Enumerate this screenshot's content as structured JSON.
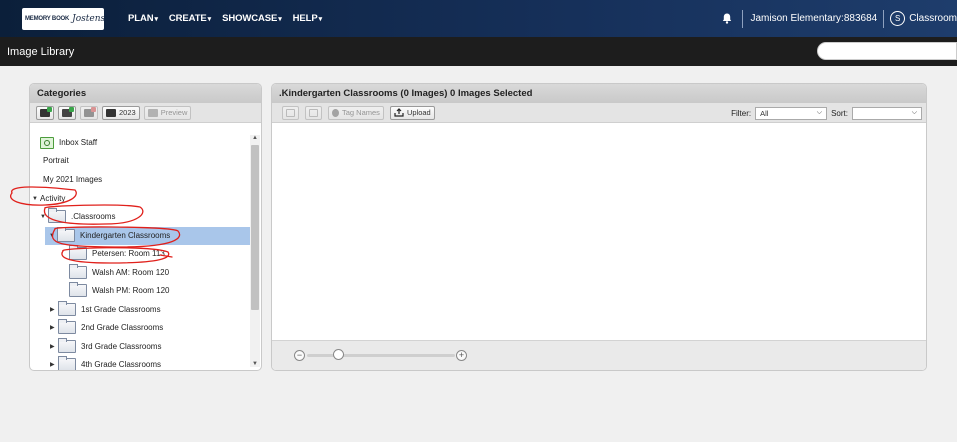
{
  "nav": {
    "logo_text_left": "MEMORY BOOK",
    "logo_text_right": "Jostens",
    "menus": [
      {
        "label": "PLAN"
      },
      {
        "label": "CREATE"
      },
      {
        "label": "SHOWCASE"
      },
      {
        "label": "HELP"
      }
    ],
    "school": "Jamison Elementary:883684",
    "avatar_letter": "S",
    "role": "Classroom"
  },
  "subbar": {
    "title": "Image Library"
  },
  "categories": {
    "title": "Categories",
    "year_button": "2023",
    "preview_button": "Preview",
    "tree": [
      {
        "label": "Inbox Staff"
      },
      {
        "label": "Portrait"
      },
      {
        "label": "My 2021 Images"
      },
      {
        "label": "Activity"
      },
      {
        "label": ".Classrooms"
      },
      {
        "label": "Kindergarten Classrooms"
      },
      {
        "label": "Petersen: Room 113"
      },
      {
        "label": "Walsh AM: Room 120"
      },
      {
        "label": "Walsh PM: Room 120"
      },
      {
        "label": "1st Grade Classrooms"
      },
      {
        "label": "2nd Grade Classrooms"
      },
      {
        "label": "3rd Grade Classrooms"
      },
      {
        "label": "4th Grade Classrooms"
      }
    ]
  },
  "images": {
    "title": ".Kindergarten Classrooms (0 Images) 0 Images Selected",
    "tag_names_button": "Tag Names",
    "upload_button": "Upload",
    "filter_label": "Filter:",
    "filter_value": "All",
    "sort_label": "Sort:",
    "sort_value": ""
  },
  "colors": {
    "nav_bg": "#16305a",
    "selected_row": "#a9c6ea",
    "annotation": "#e0201b"
  }
}
